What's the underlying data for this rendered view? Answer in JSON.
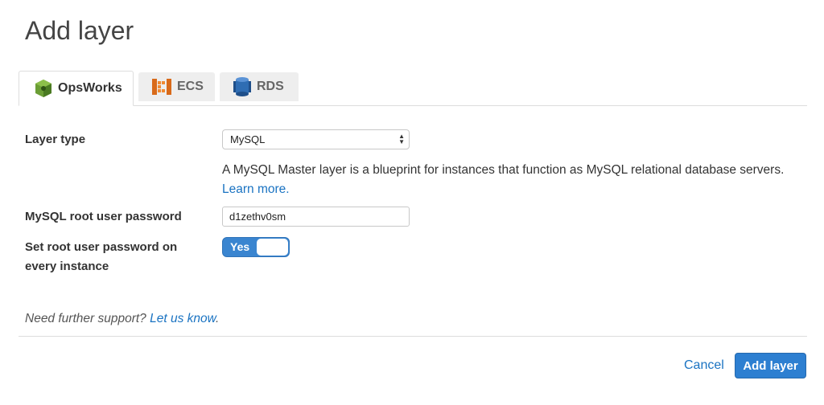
{
  "page": {
    "title": "Add layer"
  },
  "tabs": [
    {
      "label": "OpsWorks",
      "icon": "opsworks-icon",
      "active": true
    },
    {
      "label": "ECS",
      "icon": "ecs-icon",
      "active": false
    },
    {
      "label": "RDS",
      "icon": "rds-icon",
      "active": false
    }
  ],
  "form": {
    "layer_type": {
      "label": "Layer type",
      "selected": "MySQL",
      "description": "A MySQL Master layer is a blueprint for instances that function as MySQL relational database servers.",
      "learn_more": "Learn more."
    },
    "root_password": {
      "label": "MySQL root user password",
      "value": "d1zethv0sm"
    },
    "set_password": {
      "label_line1": "Set root user password on",
      "label_line2": "every instance",
      "toggle_label": "Yes",
      "value": true
    }
  },
  "support": {
    "text": "Need further support? ",
    "link": "Let us know",
    "suffix": "."
  },
  "footer": {
    "cancel_label": "Cancel",
    "submit_label": "Add layer"
  },
  "colors": {
    "accent": "#2d7fd1",
    "link": "#1a73c2",
    "opsworks": "#5a8f2a",
    "ecs": "#e07b24",
    "rds": "#2f6db3"
  }
}
